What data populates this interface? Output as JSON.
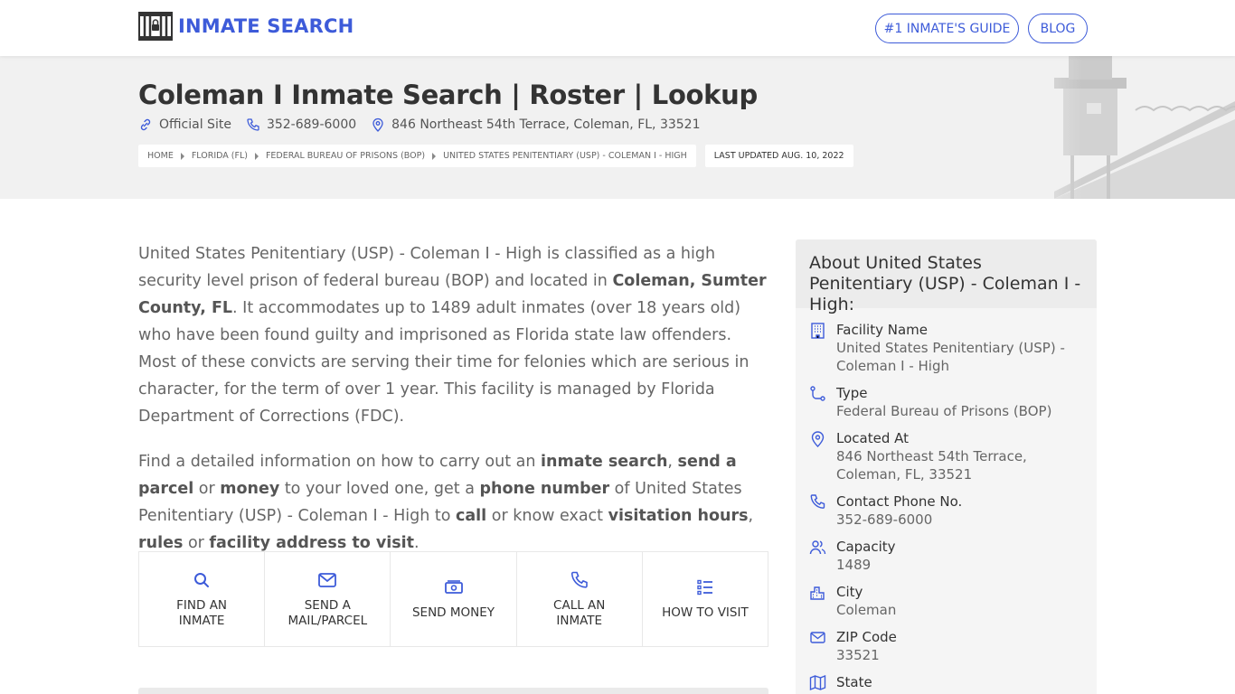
{
  "header": {
    "logo_text": "INMATE SEARCH",
    "nav": [
      {
        "label": "#1 INMATE'S GUIDE"
      },
      {
        "label": "BLOG"
      }
    ]
  },
  "hero": {
    "title": "Coleman I Inmate Search | Roster | Lookup",
    "official_site": "Official Site",
    "phone": "352-689-6000",
    "address": "846 Northeast 54th Terrace, Coleman, FL, 33521",
    "breadcrumbs": [
      "HOME",
      "FLORIDA (FL)",
      "FEDERAL BUREAU OF PRISONS (BOP)",
      "UNITED STATES PENITENTIARY (USP) - COLEMAN I - HIGH"
    ],
    "last_updated": "LAST UPDATED AUG. 10, 2022"
  },
  "intro": {
    "p1_a": "United States Penitentiary (USP) - Coleman I - High is classified as a high security level prison of federal bureau (BOP) and located in ",
    "p1_b": "Coleman, Sumter County, FL",
    "p1_c": ". It accommodates up to 1489 adult inmates (over 18 years old) who have been found guilty and imprisoned as Florida state law offenders. Most of these convicts are serving their time for felonies which are serious in character, for the term of over 1 year. This facility is managed by Florida Department of Corrections (FDC).",
    "p2_a": "Find a detailed information on how to carry out an ",
    "p2_b": "inmate search",
    "p2_c": ", ",
    "p2_d": "send a parcel",
    "p2_e": " or ",
    "p2_f": "money",
    "p2_g": " to your loved one, get a ",
    "p2_h": "phone number",
    "p2_i": " of United States Penitentiary (USP) - Coleman I - High to ",
    "p2_j": "call",
    "p2_k": " or know exact ",
    "p2_l": "visitation hours",
    "p2_m": ", ",
    "p2_n": "rules",
    "p2_o": " or ",
    "p2_p": "facility address to visit",
    "p2_q": "."
  },
  "actions": [
    {
      "line1": "FIND AN",
      "line2": "INMATE"
    },
    {
      "line1": "SEND A",
      "line2": "MAIL/PARCEL"
    },
    {
      "line1": "SEND MONEY",
      "line2": ""
    },
    {
      "line1": "CALL AN",
      "line2": "INMATE"
    },
    {
      "line1": "HOW TO VISIT",
      "line2": ""
    }
  ],
  "sidebar": {
    "title": "About United States Penitentiary (USP) - Coleman I - High:",
    "items": [
      {
        "label": "Facility Name",
        "value": "United States Penitentiary (USP) - Coleman I - High"
      },
      {
        "label": "Type",
        "value": "Federal Bureau of Prisons (BOP)"
      },
      {
        "label": "Located At",
        "value": "846 Northeast 54th Terrace, Coleman, FL, 33521"
      },
      {
        "label": "Contact Phone No.",
        "value": "352-689-6000"
      },
      {
        "label": "Capacity",
        "value": "1489"
      },
      {
        "label": "City",
        "value": "Coleman"
      },
      {
        "label": "ZIP Code",
        "value": "33521"
      },
      {
        "label": "State",
        "value": ""
      }
    ]
  },
  "colors": {
    "accent": "#3d5bd9"
  }
}
